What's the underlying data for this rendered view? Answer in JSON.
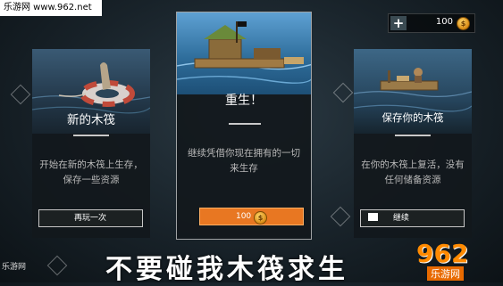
{
  "watermark_top": "乐游网 www.962.net",
  "currency": {
    "amount": "100",
    "plus_label": "+"
  },
  "cards": {
    "left": {
      "title": "新的木筏",
      "desc": "开始在新的木筏上生存，保存一些资源",
      "button": "再玩一次"
    },
    "mid": {
      "title": "重生！",
      "desc": "继续凭借你现在拥有的一切来生存",
      "button_amount": "100"
    },
    "right": {
      "title": "保存你的木筏",
      "desc": "在你的木筏上复活，没有任何储备资源",
      "button": "继续"
    }
  },
  "bottom_banner": "不要碰我木筏求生",
  "logo": {
    "big": "962",
    "small": "乐游网"
  },
  "watermark_left": "乐游网"
}
